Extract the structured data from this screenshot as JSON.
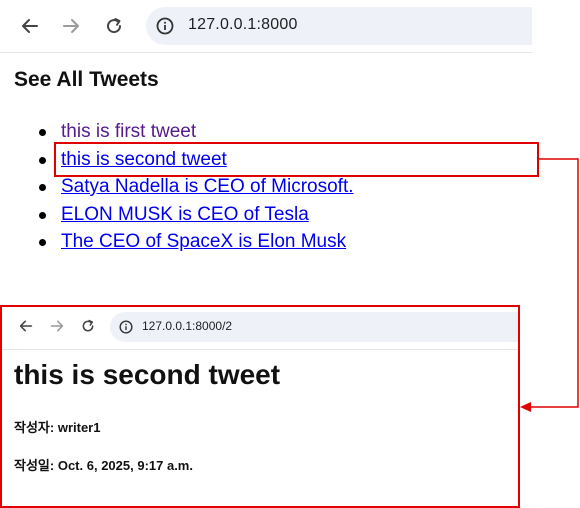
{
  "browser_main": {
    "url": "127.0.0.1:8000"
  },
  "page": {
    "title": "See All Tweets",
    "tweets": [
      {
        "text": "this is first tweet",
        "visited": true
      },
      {
        "text": "this is second tweet",
        "visited": false
      },
      {
        "text": "Satya Nadella is CEO of Microsoft.",
        "visited": false
      },
      {
        "text": "ELON MUSK is CEO of Tesla",
        "visited": false
      },
      {
        "text": "The CEO of SpaceX is Elon Musk",
        "visited": false
      }
    ]
  },
  "detail": {
    "url": "127.0.0.1:8000/2",
    "title": "this is second tweet",
    "writer_label": "작성자:",
    "writer_value": "writer1",
    "date_label": "작성일:",
    "date_value": "Oct. 6, 2025, 9:17 a.m."
  },
  "icons": [
    "back-arrow-icon",
    "forward-arrow-icon",
    "reload-icon",
    "info-icon"
  ],
  "colors": {
    "highlight": "#e00000",
    "link": "#0000ee",
    "visited_link": "#551a8b",
    "omnibox_bg": "#eef1f8"
  }
}
